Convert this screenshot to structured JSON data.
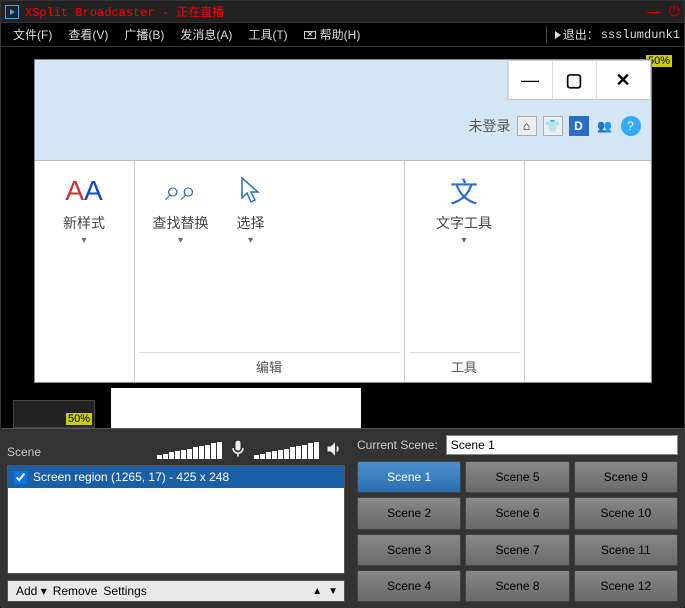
{
  "title": "XSplit Broadcaster - 正在直播",
  "menu": {
    "file": "文件(F)",
    "view": "查看(V)",
    "broadcast": "广播(B)",
    "publish": "发消息(A)",
    "tools": "工具(T)",
    "help": "帮助(H)",
    "exit": "退出：",
    "exit_user": "ssslumdunk1"
  },
  "preview": {
    "zoom": "50%",
    "captured": {
      "login": "未登录",
      "d_badge": "D",
      "min": "—",
      "max": "▢",
      "close": "✕",
      "ribbon": {
        "style_label": "新样式",
        "find_label": "查找替换",
        "select_label": "选择",
        "text_label": "文字工具",
        "group_edit": "编辑",
        "group_tools": "工具"
      }
    },
    "thumb_zoom": "50%"
  },
  "panel": {
    "scene_label": "Scene",
    "source_item": "Screen region (1265, 17) - 425 x 248",
    "add": "Add",
    "remove": "Remove",
    "settings": "Settings",
    "current_scene_label": "Current Scene:",
    "current_scene_value": "Scene 1",
    "scenes": [
      "Scene 1",
      "Scene 2",
      "Scene 3",
      "Scene 4",
      "Scene 5",
      "Scene 6",
      "Scene 7",
      "Scene 8",
      "Scene 9",
      "Scene 10",
      "Scene 11",
      "Scene 12"
    ],
    "active_index": 0
  }
}
